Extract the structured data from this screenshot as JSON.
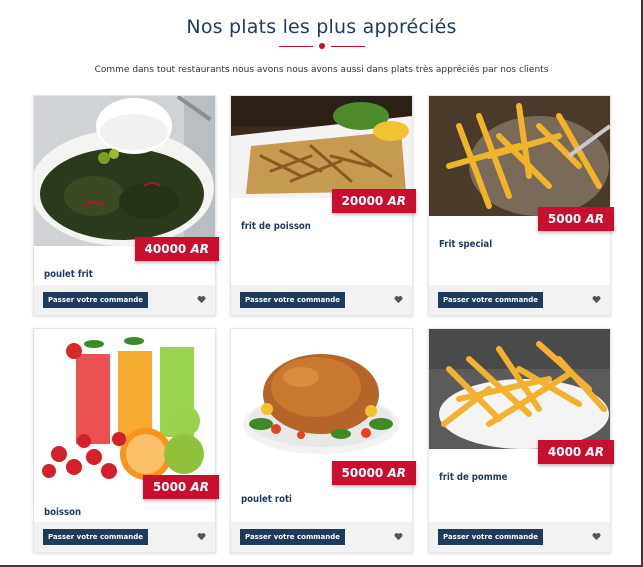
{
  "section": {
    "title": "Nos plats les plus appréciés",
    "subtitle": "Comme dans tout restaurants nous avons nous avons aussi dans plats très appréciés par nos clients"
  },
  "order_label": "Passer votre commande",
  "currency": "AR",
  "dishes": [
    {
      "name": "poulet frit",
      "price": "40000"
    },
    {
      "name": "frit de poisson",
      "price": "20000"
    },
    {
      "name": "Frit special",
      "price": "5000"
    },
    {
      "name": "boisson",
      "price": "5000"
    },
    {
      "name": "poulet roti",
      "price": "50000"
    },
    {
      "name": "frit de pomme",
      "price": "4000"
    }
  ],
  "colors": {
    "accent": "#c8102e",
    "navy": "#1f3b5c",
    "footer": "#f2f2f2"
  },
  "icons": {
    "favorite": "heart-icon"
  }
}
